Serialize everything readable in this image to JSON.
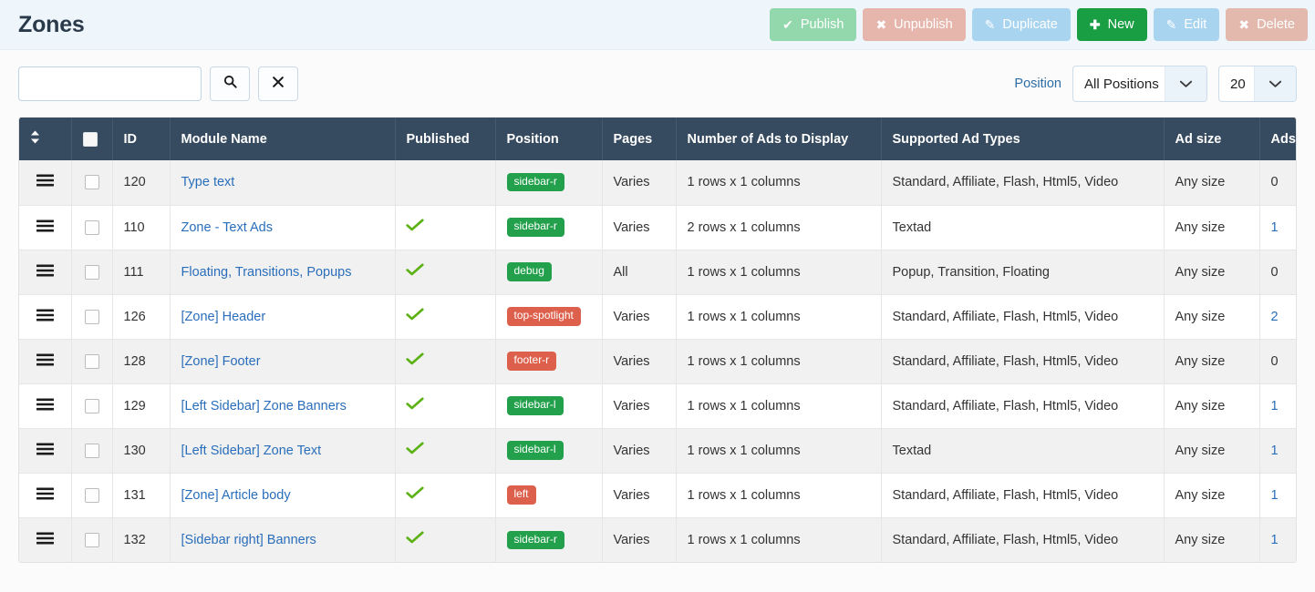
{
  "header": {
    "title": "Zones",
    "toolbar": [
      {
        "label": "Publish",
        "icon": "check-icon",
        "glyph": "✔",
        "style": "publish",
        "disabled": true
      },
      {
        "label": "Unpublish",
        "icon": "x-icon",
        "glyph": "✖",
        "style": "unpublish",
        "disabled": true
      },
      {
        "label": "Duplicate",
        "icon": "copy-edit-icon",
        "glyph": "✎",
        "style": "duplicate",
        "disabled": true
      },
      {
        "label": "New",
        "icon": "plus-icon",
        "glyph": "✚",
        "style": "new",
        "disabled": false
      },
      {
        "label": "Edit",
        "icon": "pencil-square-icon",
        "glyph": "✎",
        "style": "edit",
        "disabled": true
      },
      {
        "label": "Delete",
        "icon": "x-icon",
        "glyph": "✖",
        "style": "delete",
        "disabled": true
      }
    ]
  },
  "filters": {
    "search_value": "",
    "search_placeholder": "",
    "search_button_icon": "search-icon",
    "clear_button_icon": "clear-x-icon",
    "position_label": "Position",
    "position_value": "All Positions",
    "limit_value": "20",
    "dropdown_icon": "chevron-down-icon"
  },
  "table": {
    "columns": [
      {
        "key": "drag",
        "label": "",
        "icon": "sort-updown-icon"
      },
      {
        "key": "check",
        "label": "",
        "icon": "select-all-checkbox"
      },
      {
        "key": "id",
        "label": "ID"
      },
      {
        "key": "name",
        "label": "Module Name"
      },
      {
        "key": "pub",
        "label": "Published"
      },
      {
        "key": "pos",
        "label": "Position"
      },
      {
        "key": "pages",
        "label": "Pages"
      },
      {
        "key": "ads",
        "label": "Number of Ads to Display"
      },
      {
        "key": "types",
        "label": "Supported Ad Types"
      },
      {
        "key": "size",
        "label": "Ad size"
      },
      {
        "key": "count",
        "label": "Ads"
      }
    ],
    "rows": [
      {
        "id": "120",
        "name": "Type text",
        "published": false,
        "position": "sidebar-r",
        "position_color": "green",
        "pages": "Varies",
        "ads_to_display": "1 rows x 1 columns",
        "ad_types": "Standard, Affiliate, Flash, Html5, Video",
        "ad_size": "Any size",
        "ads_count": "0",
        "ads_count_link": false
      },
      {
        "id": "110",
        "name": "Zone - Text Ads",
        "published": true,
        "position": "sidebar-r",
        "position_color": "green",
        "pages": "Varies",
        "ads_to_display": "2 rows x 1 columns",
        "ad_types": "Textad",
        "ad_size": "Any size",
        "ads_count": "1",
        "ads_count_link": true
      },
      {
        "id": "111",
        "name": "Floating, Transitions, Popups",
        "published": true,
        "position": "debug",
        "position_color": "green",
        "pages": "All",
        "ads_to_display": "1 rows x 1 columns",
        "ad_types": "Popup, Transition, Floating",
        "ad_size": "Any size",
        "ads_count": "0",
        "ads_count_link": false
      },
      {
        "id": "126",
        "name": "[Zone] Header",
        "published": true,
        "position": "top-spotlight",
        "position_color": "red",
        "pages": "Varies",
        "ads_to_display": "1 rows x 1 columns",
        "ad_types": "Standard, Affiliate, Flash, Html5, Video",
        "ad_size": "Any size",
        "ads_count": "2",
        "ads_count_link": true
      },
      {
        "id": "128",
        "name": "[Zone] Footer",
        "published": true,
        "position": "footer-r",
        "position_color": "red",
        "pages": "Varies",
        "ads_to_display": "1 rows x 1 columns",
        "ad_types": "Standard, Affiliate, Flash, Html5, Video",
        "ad_size": "Any size",
        "ads_count": "0",
        "ads_count_link": false
      },
      {
        "id": "129",
        "name": "[Left Sidebar] Zone Banners",
        "published": true,
        "position": "sidebar-l",
        "position_color": "green",
        "pages": "Varies",
        "ads_to_display": "1 rows x 1 columns",
        "ad_types": "Standard, Affiliate, Flash, Html5, Video",
        "ad_size": "Any size",
        "ads_count": "1",
        "ads_count_link": true
      },
      {
        "id": "130",
        "name": "[Left Sidebar] Zone Text",
        "published": true,
        "position": "sidebar-l",
        "position_color": "green",
        "pages": "Varies",
        "ads_to_display": "1 rows x 1 columns",
        "ad_types": "Textad",
        "ad_size": "Any size",
        "ads_count": "1",
        "ads_count_link": true
      },
      {
        "id": "131",
        "name": "[Zone] Article body",
        "published": true,
        "position": "left",
        "position_color": "red",
        "pages": "Varies",
        "ads_to_display": "1 rows x 1 columns",
        "ad_types": "Standard, Affiliate, Flash, Html5, Video",
        "ad_size": "Any size",
        "ads_count": "1",
        "ads_count_link": true
      },
      {
        "id": "132",
        "name": "[Sidebar right] Banners",
        "published": true,
        "position": "sidebar-r",
        "position_color": "green",
        "pages": "Varies",
        "ads_to_display": "1 rows x 1 columns",
        "ad_types": "Standard, Affiliate, Flash, Html5, Video",
        "ad_size": "Any size",
        "ads_count": "1",
        "ads_count_link": true
      }
    ],
    "icons": {
      "drag_handle": "drag-handle-icon",
      "row_checkbox": "row-checkbox",
      "published_check": "green-check-icon"
    }
  },
  "colors": {
    "header_bg": "#eef6fc",
    "table_head_bg": "#374b60",
    "link": "#2a6ebb",
    "badge_green": "#22a04b",
    "badge_red": "#dd604c",
    "new_button": "#1a9e44"
  }
}
